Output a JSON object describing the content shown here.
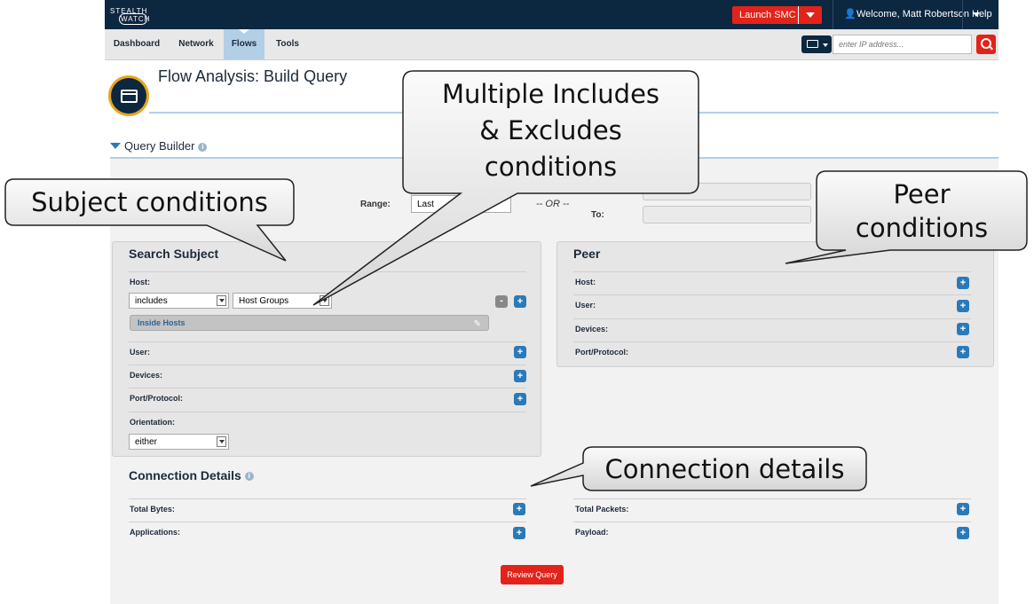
{
  "header": {
    "logo_line1": "STEALTH",
    "logo_line2": "WATCH",
    "launch_label": "Launch SMC",
    "welcome_label": "Welcome, Matt Robertson",
    "help_label": "Help"
  },
  "nav": {
    "tabs": [
      {
        "label": "Dashboard"
      },
      {
        "label": "Network"
      },
      {
        "label": "Flows"
      },
      {
        "label": "Tools"
      }
    ],
    "active_tab": "Flows",
    "ip_placeholder": "enter IP address..."
  },
  "page": {
    "title": "Flow Analysis: Build Query",
    "section_label": "Query Builder"
  },
  "time": {
    "range_label": "Range:",
    "range_value": "Last",
    "or_label": "-- OR --",
    "to_label": "To:"
  },
  "subject": {
    "title": "Search Subject",
    "host_label": "Host:",
    "include_select": "includes",
    "type_select": "Host Groups",
    "tag_value": "Inside Hosts",
    "user_label": "User:",
    "devices_label": "Devices:",
    "port_label": "Port/Protocol:",
    "orientation_label": "Orientation:",
    "orientation_value": "either"
  },
  "peer": {
    "title": "Peer",
    "host_label": "Host:",
    "user_label": "User:",
    "devices_label": "Devices:",
    "port_label": "Port/Protocol:"
  },
  "connection": {
    "title": "Connection Details",
    "total_bytes_label": "Total Bytes:",
    "applications_label": "Applications:",
    "total_packets_label": "Total Packets:",
    "payload_label": "Payload:"
  },
  "review_label": "Review Query",
  "callouts": {
    "multiple": [
      "Multiple Includes",
      "& Excludes",
      "conditions"
    ],
    "subject": "Subject conditions",
    "peer": [
      "Peer",
      "conditions"
    ],
    "connection": "Connection details"
  },
  "colors": {
    "header_bg": "#0c2740",
    "accent_red": "#e2231a",
    "accent_blue": "#2a7ab9",
    "nav_active": "#b3cfe5",
    "icon_gold": "#e9a51d"
  },
  "icons": {
    "user": "user-icon",
    "search": "search-icon",
    "monitor": "monitor-icon",
    "pencil": "pencil-icon",
    "flow": "window-icon"
  }
}
